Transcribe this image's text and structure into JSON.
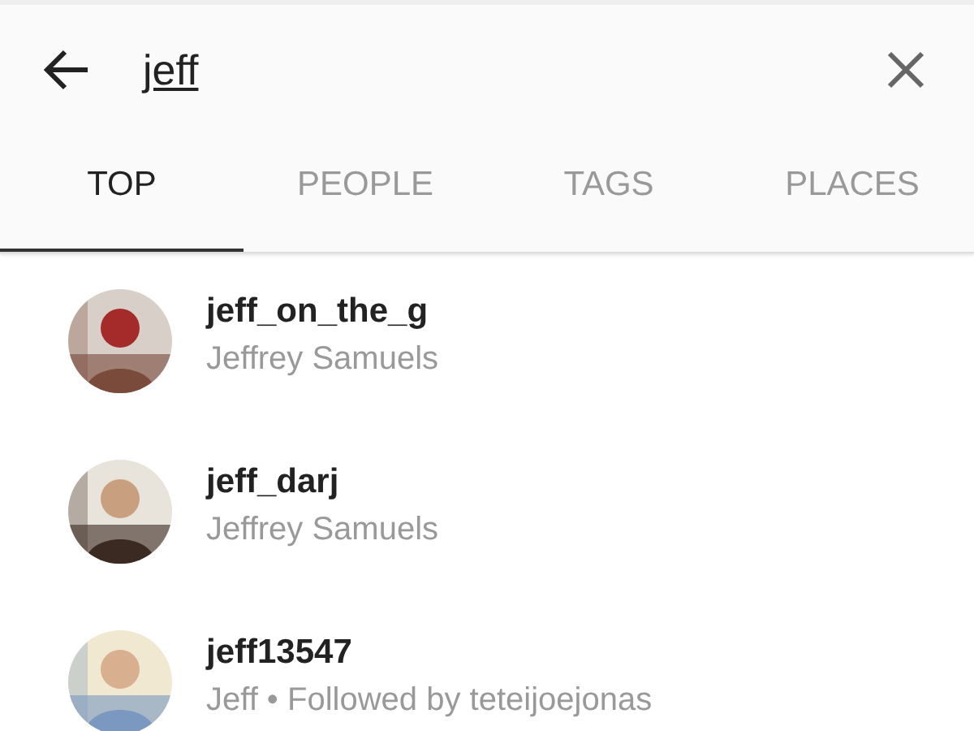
{
  "search": {
    "value": "jeff"
  },
  "tabs": [
    {
      "label": "TOP",
      "selected": true
    },
    {
      "label": "PEOPLE",
      "selected": false
    },
    {
      "label": "TAGS",
      "selected": false
    },
    {
      "label": "PLACES",
      "selected": false
    }
  ],
  "results": [
    {
      "username": "jeff_on_the_g",
      "subtitle": "Jeffrey Samuels"
    },
    {
      "username": "jeff_darj",
      "subtitle": "Jeffrey Samuels"
    },
    {
      "username": "jeff13547",
      "subtitle": "Jeff • Followed by teteijoejonas"
    }
  ]
}
